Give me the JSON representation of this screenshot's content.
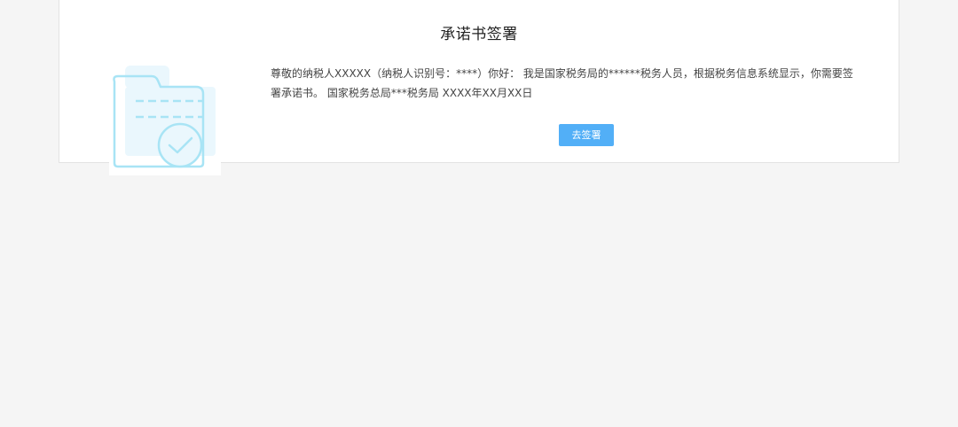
{
  "page": {
    "title": "承诺书签署",
    "message": "尊敬的纳税人XXXXX（纳税人识别号：****）你好： 我是国家税务局的******税务人员，根据税务信息系统显示，你需要签署承诺书。 国家税务总局***税务局 XXXX年XX月XX日",
    "sign_button_label": "去签署"
  },
  "colors": {
    "background": "#f5f5f5",
    "card": "#ffffff",
    "button": "#52aff7",
    "illustration_stroke": "#a8e4f5",
    "illustration_fill": "#eaf7fd"
  },
  "icons": {
    "illustration": "folder-check-icon"
  }
}
